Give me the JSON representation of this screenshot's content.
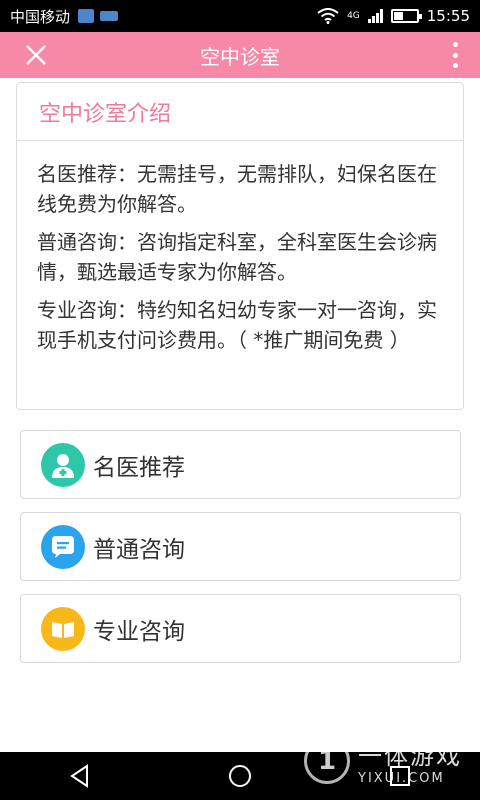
{
  "status_bar": {
    "carrier": "中国移动",
    "network": "4G",
    "time": "15:55",
    "battery_level": 0.4
  },
  "header": {
    "title": "空中诊室",
    "close_icon": "close-icon",
    "more_icon": "more-vertical-icon"
  },
  "intro": {
    "title": "空中诊室介绍",
    "paragraphs": [
      "名医推荐：无需挂号，无需排队，妇保名医在线免费为你解答。",
      "普通咨询：咨询指定科室，全科室医生会诊病情，甄选最适专家为你解答。",
      "专业咨询：特约知名妇幼专家一对一咨询，实现手机支付问诊费用。（ *推广期间免费 ）"
    ]
  },
  "menu": [
    {
      "label": "名医推荐",
      "icon": "doctor-icon",
      "color": "#2ec8a8"
    },
    {
      "label": "普通咨询",
      "icon": "chat-icon",
      "color": "#2ba4ee"
    },
    {
      "label": "专业咨询",
      "icon": "book-icon",
      "color": "#f9b81a"
    }
  ],
  "colors": {
    "accent": "#f789a6",
    "intro_title": "#ef7a99"
  },
  "watermark": {
    "cn": "一体游戏",
    "en": "YIXUI.COM"
  }
}
